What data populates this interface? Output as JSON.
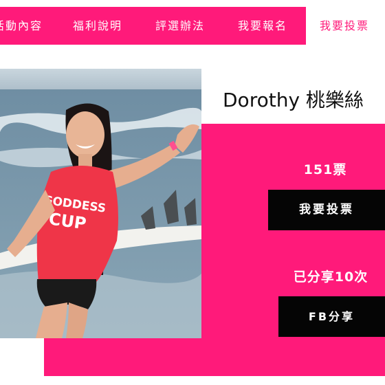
{
  "nav": {
    "items": [
      {
        "label": "活動內容"
      },
      {
        "label": "福利說明"
      },
      {
        "label": "評選辦法"
      },
      {
        "label": "我要報名"
      },
      {
        "label": "我要投票"
      }
    ]
  },
  "contestant": {
    "name": "Dorothy 桃樂絲",
    "photo_shirt_text": "GODDESS CUP"
  },
  "stats": {
    "votes": "151票",
    "shares": "已分享10次"
  },
  "buttons": {
    "vote": "我要投票",
    "fb_share": "FB分享"
  },
  "colors": {
    "accent": "#ff1a7a",
    "button_bg": "#050505",
    "text_light": "#ffffff"
  }
}
